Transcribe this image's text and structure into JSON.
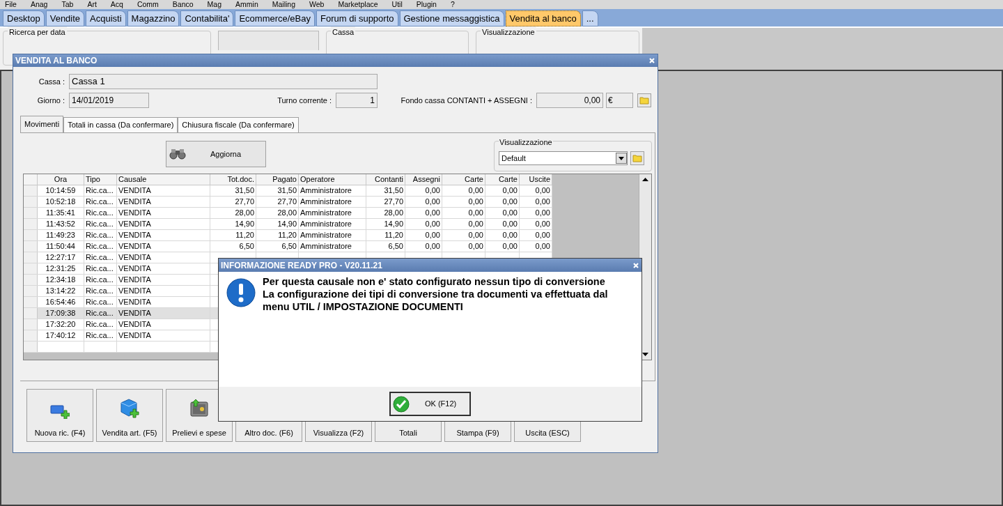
{
  "menu_bar": [
    "File",
    "Anag",
    "Tab",
    "Art",
    "Acq",
    "Comm",
    "Banco",
    "Mag",
    "Ammin",
    "Mailing",
    "Web",
    "Marketplace",
    "Util",
    "Plugin",
    "?"
  ],
  "module_tabs": [
    {
      "label": "Desktop",
      "selected": false
    },
    {
      "label": "Vendite",
      "selected": false
    },
    {
      "label": "Acquisti",
      "selected": false
    },
    {
      "label": "Magazzino",
      "selected": false
    },
    {
      "label": "Contabilita'",
      "selected": false
    },
    {
      "label": "Ecommerce/eBay",
      "selected": false
    },
    {
      "label": "Forum di supporto",
      "selected": false
    },
    {
      "label": "Gestione messaggistica",
      "selected": false
    },
    {
      "label": "Vendita al banco",
      "selected": true
    },
    {
      "label": "...",
      "selected": false
    }
  ],
  "background_form": {
    "groups": [
      "Ricerca per data",
      "Cassa",
      "Visualizzazione"
    ]
  },
  "window": {
    "title": "VENDITA AL BANCO",
    "cassa": {
      "label": "Cassa :",
      "value": "Cassa 1"
    },
    "giorno": {
      "label": "Giorno :",
      "value": "14/01/2019"
    },
    "turno": {
      "label": "Turno corrente :",
      "value": "1"
    },
    "fondo": {
      "label": "Fondo cassa CONTANTI + ASSEGNI :",
      "value": "0,00",
      "currency": "€"
    },
    "tabs": [
      {
        "label": "Movimenti",
        "selected": true
      },
      {
        "label": "Totali in cassa (Da confermare)",
        "selected": false
      },
      {
        "label": "Chiusura fiscale (Da confermare)",
        "selected": false
      }
    ],
    "refresh_button": "Aggiorna",
    "view": {
      "label": "Visualizzazione",
      "value": "Default"
    },
    "table": {
      "columns": [
        "Ora",
        "Tipo",
        "Causale",
        "Tot.doc.",
        "Pagato",
        "Operatore",
        "Contanti",
        "Assegni",
        "Carte",
        "Carte",
        "Uscite"
      ],
      "rows": [
        {
          "selected": false,
          "cells": [
            "10:14:59",
            "Ric.ca...",
            "VENDITA",
            "31,50",
            "31,50",
            "Amministratore",
            "31,50",
            "0,00",
            "0,00",
            "0,00",
            "0,00"
          ]
        },
        {
          "selected": false,
          "cells": [
            "10:52:18",
            "Ric.ca...",
            "VENDITA",
            "27,70",
            "27,70",
            "Amministratore",
            "27,70",
            "0,00",
            "0,00",
            "0,00",
            "0,00"
          ]
        },
        {
          "selected": false,
          "cells": [
            "11:35:41",
            "Ric.ca...",
            "VENDITA",
            "28,00",
            "28,00",
            "Amministratore",
            "28,00",
            "0,00",
            "0,00",
            "0,00",
            "0,00"
          ]
        },
        {
          "selected": false,
          "cells": [
            "11:43:52",
            "Ric.ca...",
            "VENDITA",
            "14,90",
            "14,90",
            "Amministratore",
            "14,90",
            "0,00",
            "0,00",
            "0,00",
            "0,00"
          ]
        },
        {
          "selected": false,
          "cells": [
            "11:49:23",
            "Ric.ca...",
            "VENDITA",
            "11,20",
            "11,20",
            "Amministratore",
            "11,20",
            "0,00",
            "0,00",
            "0,00",
            "0,00"
          ]
        },
        {
          "selected": false,
          "cells": [
            "11:50:44",
            "Ric.ca...",
            "VENDITA",
            "6,50",
            "6,50",
            "Amministratore",
            "6,50",
            "0,00",
            "0,00",
            "0,00",
            "0,00"
          ]
        },
        {
          "selected": false,
          "cells": [
            "12:27:17",
            "Ric.ca...",
            "VENDITA"
          ]
        },
        {
          "selected": false,
          "cells": [
            "12:31:25",
            "Ric.ca...",
            "VENDITA"
          ]
        },
        {
          "selected": false,
          "cells": [
            "12:34:18",
            "Ric.ca...",
            "VENDITA"
          ]
        },
        {
          "selected": false,
          "cells": [
            "13:14:22",
            "Ric.ca...",
            "VENDITA"
          ]
        },
        {
          "selected": false,
          "cells": [
            "16:54:46",
            "Ric.ca...",
            "VENDITA"
          ]
        },
        {
          "selected": true,
          "cells": [
            "17:09:38",
            "Ric.ca...",
            "VENDITA"
          ]
        },
        {
          "selected": false,
          "cells": [
            "17:32:20",
            "Ric.ca...",
            "VENDITA"
          ]
        },
        {
          "selected": false,
          "cells": [
            "17:40:12",
            "Ric.ca...",
            "VENDITA"
          ]
        }
      ]
    },
    "buttons": [
      {
        "label": "Nuova ric. (F4)",
        "kind": "monitor"
      },
      {
        "label": "Vendita art. (F5)",
        "kind": "cube"
      },
      {
        "label": "Prelievi e spese",
        "kind": "safe"
      },
      {
        "label": "Altro doc. (F6)",
        "kind": "none"
      },
      {
        "label": "Visualizza (F2)",
        "kind": "none"
      },
      {
        "label": "Totali",
        "kind": "none"
      },
      {
        "label": "Stampa (F9)",
        "kind": "none"
      },
      {
        "label": "Uscita (ESC)",
        "kind": "none"
      }
    ]
  },
  "dialog": {
    "title": "INFORMAZIONE READY PRO - V20.11.21",
    "lines": [
      "Per questa causale non e' stato configurato nessun tipo di conversione",
      "La configurazione dei tipi di conversione tra documenti va effettuata dal",
      "menu UTIL / IMPOSTAZIONE DOCUMENTI"
    ],
    "ok_button": "OK (F12)"
  }
}
